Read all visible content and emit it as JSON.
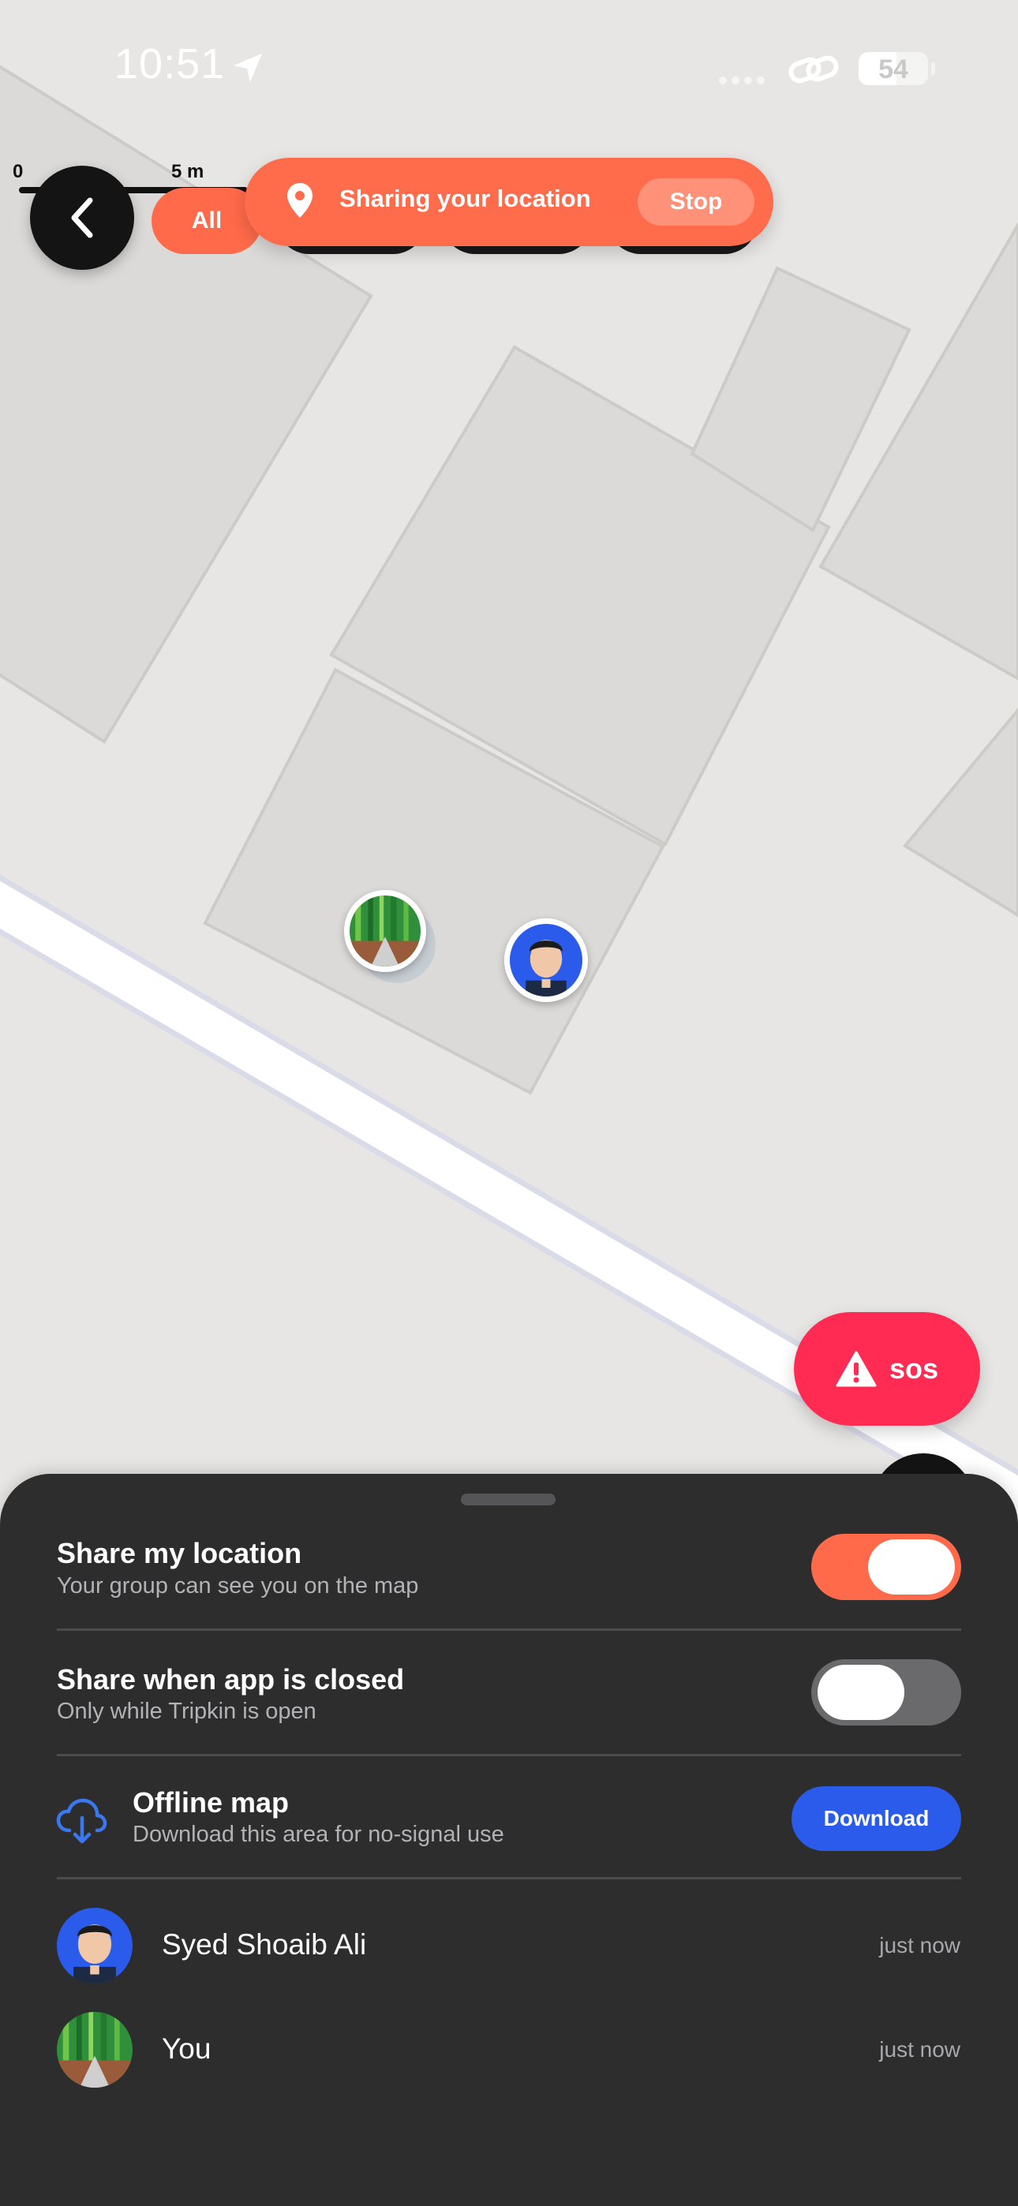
{
  "status_bar": {
    "time": "10:51",
    "battery_percent": "54",
    "battery_level": 0.54
  },
  "map": {
    "scale_zero": "0",
    "scale_max": "5 m"
  },
  "top_bar": {
    "filter_all_label": "All",
    "sharing_text": "Sharing your location",
    "stop_label": "Stop",
    "accent_color": "#ff6c4c"
  },
  "sos": {
    "label": "sos",
    "color": "#ff2b52"
  },
  "sheet": {
    "share_location": {
      "title": "Share my location",
      "subtitle": "Your group can see you on the map",
      "enabled": true
    },
    "share_closed": {
      "title": "Share when app is closed",
      "subtitle": "Only while Tripkin is open",
      "enabled": false
    },
    "offline_map": {
      "icon": "cloud-download-icon",
      "title": "Offline map",
      "subtitle": "Download this area for no-signal use",
      "button_label": "Download",
      "button_color": "#2a5bea"
    },
    "members": [
      {
        "name": "Syed Shoaib Ali",
        "time": "just now",
        "avatar": "portrait-avatar"
      },
      {
        "name": "You",
        "time": "just now",
        "avatar": "forest-avatar"
      }
    ]
  }
}
